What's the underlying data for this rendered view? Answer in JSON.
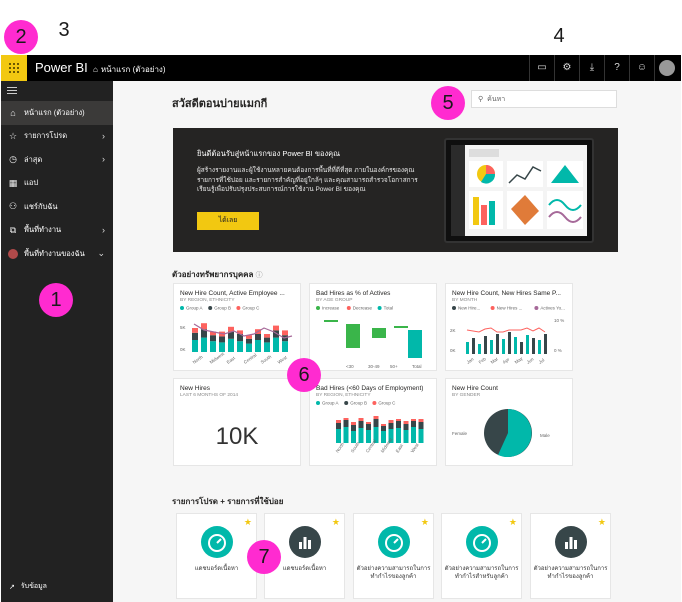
{
  "callouts": [
    "1",
    "2",
    "3",
    "4",
    "5",
    "6",
    "7"
  ],
  "topbar": {
    "brand": "Power BI",
    "breadcrumb": "หน้าแรก (ตัวอย่าง)",
    "icons": [
      "chat-icon",
      "gear-icon",
      "download-icon",
      "help-icon",
      "smile-icon",
      "account-icon"
    ]
  },
  "sidebar": {
    "items": [
      {
        "label": "หน้าแรก (ตัวอย่าง)",
        "icon": "home-icon"
      },
      {
        "label": "รายการโปรด",
        "icon": "star-icon"
      },
      {
        "label": "ล่าสุด",
        "icon": "clock-icon"
      },
      {
        "label": "แอป",
        "icon": "apps-icon"
      },
      {
        "label": "แชร์กับฉัน",
        "icon": "shared-icon"
      },
      {
        "label": "พื้นที่ทำงาน",
        "icon": "workspaces-icon"
      },
      {
        "label": "พื้นที่ทำงานของฉัน",
        "icon": "avatar"
      }
    ],
    "get_data": "รับข้อมูล"
  },
  "main": {
    "title": "สวัสดีตอนบ่ายแมกกี",
    "search_placeholder": "ค้นหา",
    "banner": {
      "title": "ยินดีต้อนรับสู่หน้าแรกของ Power BI ของคุณ",
      "body": "ผู้สร้างรายงานและผู้ใช้งานหลายคนต้องการพื้นที่ที่ดีที่สุด ภายในองค์กรของคุณ รายการที่ใช้บ่อย และรายการสำคัญที่อยู่ใกล้ๆ และคุณสามารถสำรวจโอกาสการเรียนรู้เพื่อปรับปรุงประสบการณ์การใช้งาน Power BI ของคุณ",
      "button": "ได้เลย"
    },
    "section_samples": "ตัวอย่างทรัพยากรบุคคล",
    "section_favorites": "รายการโปรด + รายการที่ใช้บ่อย",
    "tiles": [
      {
        "title": "New Hire Count, Active Employee ...",
        "sub": "BY REGION, ETHNICITY",
        "legend": [
          "Group A",
          "Group B",
          "Group C"
        ],
        "yticks": [
          "5K",
          "0K"
        ],
        "xticks": [
          "North",
          "Midwest",
          "East",
          "Central",
          "South",
          "West"
        ]
      },
      {
        "title": "Bad Hires as % of Actives",
        "sub": "BY AGE GROUP",
        "legend": [
          "Increase",
          "Decrease",
          "Total"
        ],
        "xticks": [
          "<30",
          "30-49",
          "50+",
          "Total"
        ]
      },
      {
        "title": "New Hire Count, New Hires Same P...",
        "sub": "BY MONTH",
        "legend": [
          "New Hire...",
          "New Hires ...",
          "Actives Yo..."
        ],
        "yticks": [
          "2K",
          "0K"
        ],
        "y2ticks": [
          "10 %",
          "0 %"
        ],
        "xticks": [
          "Jan",
          "Feb",
          "Mar",
          "Apr",
          "May",
          "Jun",
          "Jul"
        ]
      },
      {
        "title": "New Hires",
        "sub": "LAST 6 MONTHS OF 2014",
        "value": "10K"
      },
      {
        "title": "Bad Hires (<60 Days of Employment)",
        "sub": "BY REGION, ETHNICITY",
        "legend": [
          "Group A",
          "Group B",
          "Group C"
        ],
        "xticks": [
          "North",
          "South",
          "Central",
          "Midwest",
          "East",
          "West"
        ]
      },
      {
        "title": "New Hire Count",
        "sub": "BY GENDER",
        "labels": [
          "Female",
          "Male"
        ]
      }
    ],
    "favorites": [
      {
        "label": "แดชบอร์ดเนื้อหา",
        "icon": "gauge-icon",
        "color": "#01b8aa"
      },
      {
        "label": "แดชบอร์ดเนื้อหา",
        "icon": "bar-chart-icon",
        "color": "#374649"
      },
      {
        "label": "ตัวอย่างความสามารถในการทำกำไรของลูกค้า",
        "icon": "gauge-icon",
        "color": "#01b8aa"
      },
      {
        "label": "ตัวอย่างความสามารถในการทำกำไรสำหรับลูกค้า",
        "icon": "gauge-icon",
        "color": "#01b8aa"
      },
      {
        "label": "ตัวอย่างความสามารถในการทำกำไรของลูกค้า",
        "icon": "bar-chart-icon",
        "color": "#374649"
      }
    ]
  },
  "colors": {
    "accent": "#f2c811",
    "teal": "#01b8aa",
    "dark": "#374649",
    "red": "#fd625e",
    "purple": "#a66999",
    "green": "#3ab54a"
  }
}
